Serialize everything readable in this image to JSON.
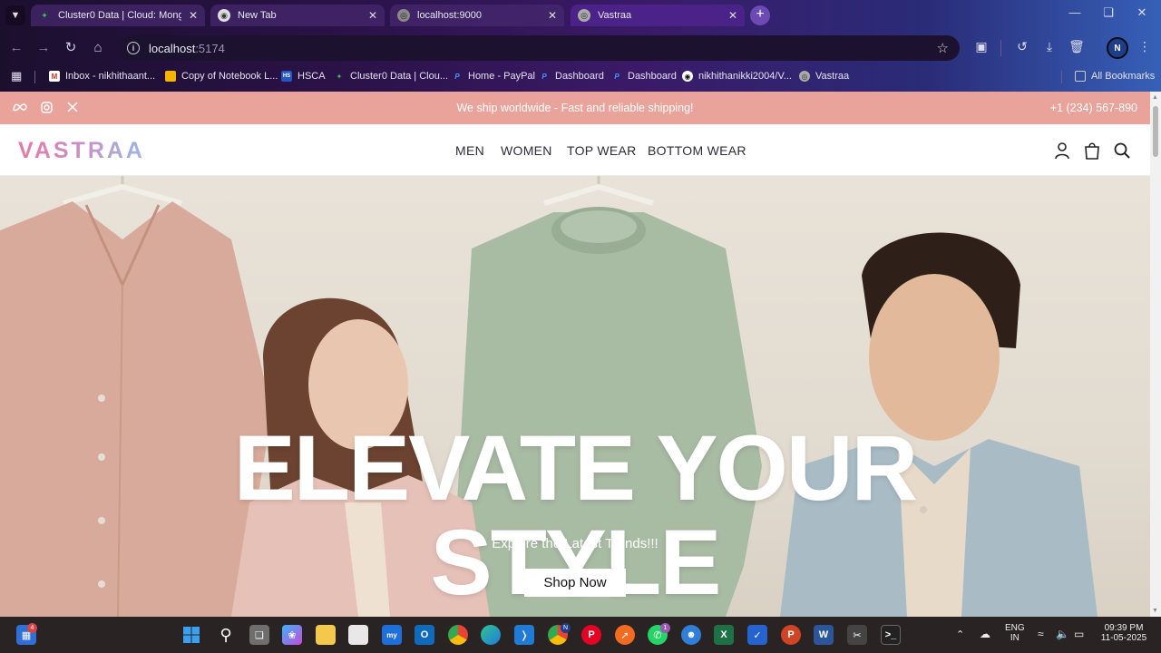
{
  "browser": {
    "tabs": [
      {
        "title": "Cluster0 Data | Cloud: MongoDB",
        "icon": "mongodb-leaf-icon",
        "active": false
      },
      {
        "title": "New Tab",
        "icon": "chrome-icon",
        "active": false
      },
      {
        "title": "localhost:9000",
        "icon": "globe-icon",
        "active": false
      },
      {
        "title": "Vastraa",
        "icon": "globe-icon",
        "active": true
      }
    ],
    "url_host": "localhost",
    "url_port": ":5174",
    "profile_initial": "N",
    "bookmarks": [
      {
        "label": "Inbox - nikhithaant...",
        "icon": "gmail-icon"
      },
      {
        "label": "Copy of Notebook L...",
        "icon": "slides-icon"
      },
      {
        "label": "HSCA",
        "icon": "hsca-icon",
        "icon_text": "HS"
      },
      {
        "label": "Cluster0 Data | Clou...",
        "icon": "mongodb-leaf-icon"
      },
      {
        "label": "Home - PayPal",
        "icon": "paypal-icon"
      },
      {
        "label": "Dashboard",
        "icon": "paypal-icon"
      },
      {
        "label": "Dashboard",
        "icon": "paypal-icon"
      },
      {
        "label": "nikhithanikki2004/V...",
        "icon": "github-icon"
      },
      {
        "label": "Vastraa",
        "icon": "globe-icon"
      }
    ],
    "all_bookmarks": "All Bookmarks"
  },
  "site": {
    "announcement": "We ship worldwide - Fast and reliable shipping!",
    "phone": "+1 (234) 567-890",
    "logo": "VASTRAA",
    "menu": [
      "MEN",
      "WOMEN",
      "TOP WEAR",
      "BOTTOM WEAR"
    ],
    "hero": {
      "line1": "ELEVATE YOUR",
      "line2": "STYLE",
      "subtitle": "Explore the Latest Trends!!!",
      "cta": "Shop Now"
    }
  },
  "taskbar": {
    "widgets_badge": "4",
    "whatsapp_badge": "1",
    "language": "ENG",
    "region": "IN",
    "time": "09:39 PM",
    "date": "11-05-2025",
    "chrome_profile_badge": "N"
  },
  "colors": {
    "announcement_bg": "#e9a39a",
    "logo_gradient": [
      "#e77aa8",
      "#9bb7e6"
    ],
    "chrome_frame": "#3a1a68"
  }
}
